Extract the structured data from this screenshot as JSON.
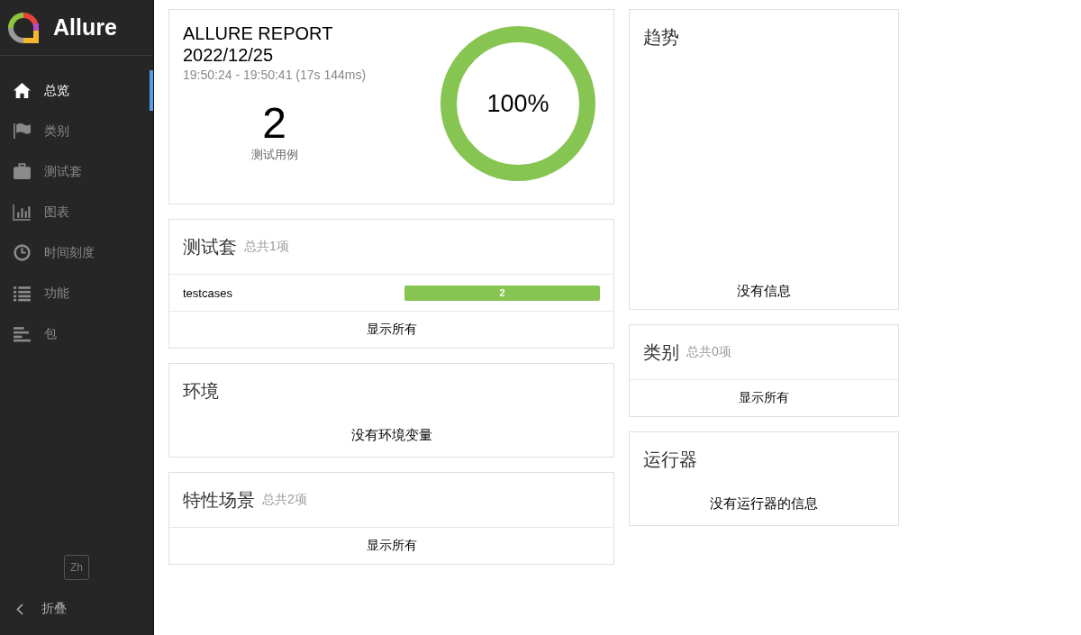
{
  "sidebar": {
    "brand": "Allure",
    "nav": [
      {
        "label": "总览",
        "kind": "home",
        "selected": true
      },
      {
        "label": "类别",
        "kind": "flag",
        "selected": false
      },
      {
        "label": "测试套",
        "kind": "briefcase",
        "selected": false
      },
      {
        "label": "图表",
        "kind": "chart",
        "selected": false
      },
      {
        "label": "时间刻度",
        "kind": "clock",
        "selected": false
      },
      {
        "label": "功能",
        "kind": "list",
        "selected": false
      },
      {
        "label": "包",
        "kind": "bars",
        "selected": false
      }
    ],
    "language": "Zh",
    "collapse": "折叠"
  },
  "columns": [
    [
      {
        "kind": "summary",
        "title": "ALLURE REPORT",
        "date": "2022/12/25",
        "time_range": "19:50:24 - 19:50:41 (17s 144ms)",
        "test_count": "2",
        "test_count_label": "测试用例",
        "percent": "100%",
        "level": 1
      },
      {
        "kind": "list",
        "title": "测试套",
        "total": "总共1项",
        "rows": [
          {
            "name": "testcases",
            "value": "2",
            "level": 1
          }
        ],
        "link": "显示所有"
      },
      {
        "kind": "message",
        "title": "环境",
        "message": "没有环境变量"
      },
      {
        "kind": "list",
        "title": "特性场景",
        "total": "总共2项",
        "link": "显示所有"
      }
    ],
    [
      {
        "kind": "trend",
        "title": "趋势",
        "message": "没有信息"
      },
      {
        "kind": "list",
        "title": "类别",
        "total": "总共0项",
        "link": "显示所有"
      },
      {
        "kind": "message",
        "title": "运行器",
        "message": "没有运行器的信息"
      }
    ]
  ]
}
